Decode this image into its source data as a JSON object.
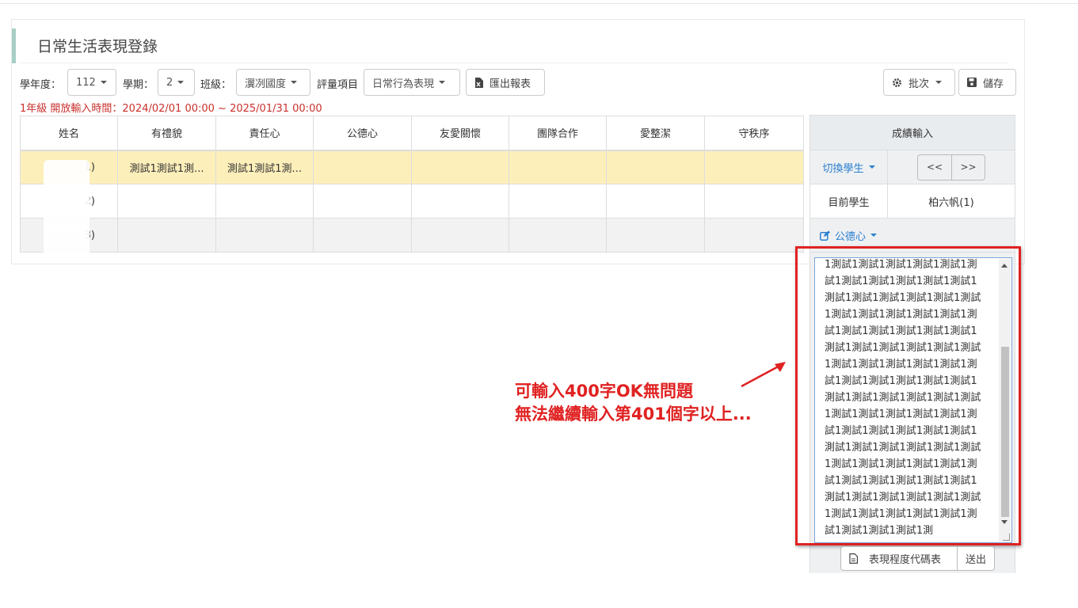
{
  "page": {
    "title": "日常生活表現登錄"
  },
  "filters": {
    "year_label": "學年度：",
    "year_value": "112",
    "semester_label": "學期：",
    "semester_value": "2",
    "class_label": "班級：",
    "class_value": "瀷冽國度",
    "item_label": "評量項目",
    "item_value": "日常行為表現",
    "export_label": "匯出報表",
    "batch_label": "批次",
    "save_label": "儲存"
  },
  "notice": "1年級 開放輸入時間：2024/02/01 00:00 ~ 2025/01/31 00:00",
  "table": {
    "headers": [
      "姓名",
      "有禮貌",
      "責任心",
      "公德心",
      "友愛關懷",
      "團隊合作",
      "愛整潔",
      "守秩序"
    ],
    "rows": [
      [
        "1)",
        "測試1測試1測...",
        "測試1測試1測...",
        "",
        "",
        "",
        "",
        ""
      ],
      [
        " 2)",
        "",
        "",
        "",
        "",
        "",
        "",
        ""
      ],
      [
        " 3)",
        "",
        "",
        "",
        "",
        "",
        "",
        ""
      ]
    ]
  },
  "score_panel": {
    "header": "成績輸入",
    "switch_label": "切換學生",
    "prev_label": "<<",
    "next_label": ">>",
    "current_label": "目前學生",
    "current_value": "柏六帆(1)",
    "field_label": "公德心",
    "textarea_lines": [
      "1測試1測試1測試1測試1測試1測",
      "試1測試1測試1測試1測試1測試1",
      "測試1測試1測試1測試1測試1測試",
      "1測試1測試1測試1測試1測試1測",
      "試1測試1測試1測試1測試1測試1",
      "測試1測試1測試1測試1測試1測試",
      "1測試1測試1測試1測試1測試1測",
      "試1測試1測試1測試1測試1測試1",
      "測試1測試1測試1測試1測試1測試",
      "1測試1測試1測試1測試1測試1測",
      "試1測試1測試1測試1測試1測試1",
      "測試1測試1測試1測試1測試1測試",
      "1測試1測試1測試1測試1測試1測",
      "試1測試1測試1測試1測試1測試1",
      "測試1測試1測試1測試1測試1測試",
      "1測試1測試1測試1測試1測試1測",
      "試1測試1測試1測試1測"
    ],
    "code_table_label": "表現程度代碼表",
    "submit_label": "送出"
  },
  "annotation": {
    "line1": "可輸入400字OK無問題",
    "line2": "無法繼續輸入第401個字以上..."
  },
  "colors": {
    "accent": "#a8cfc5",
    "selected_row": "#fdefba",
    "link": "#2a7fcf",
    "warning": "#e02222"
  }
}
